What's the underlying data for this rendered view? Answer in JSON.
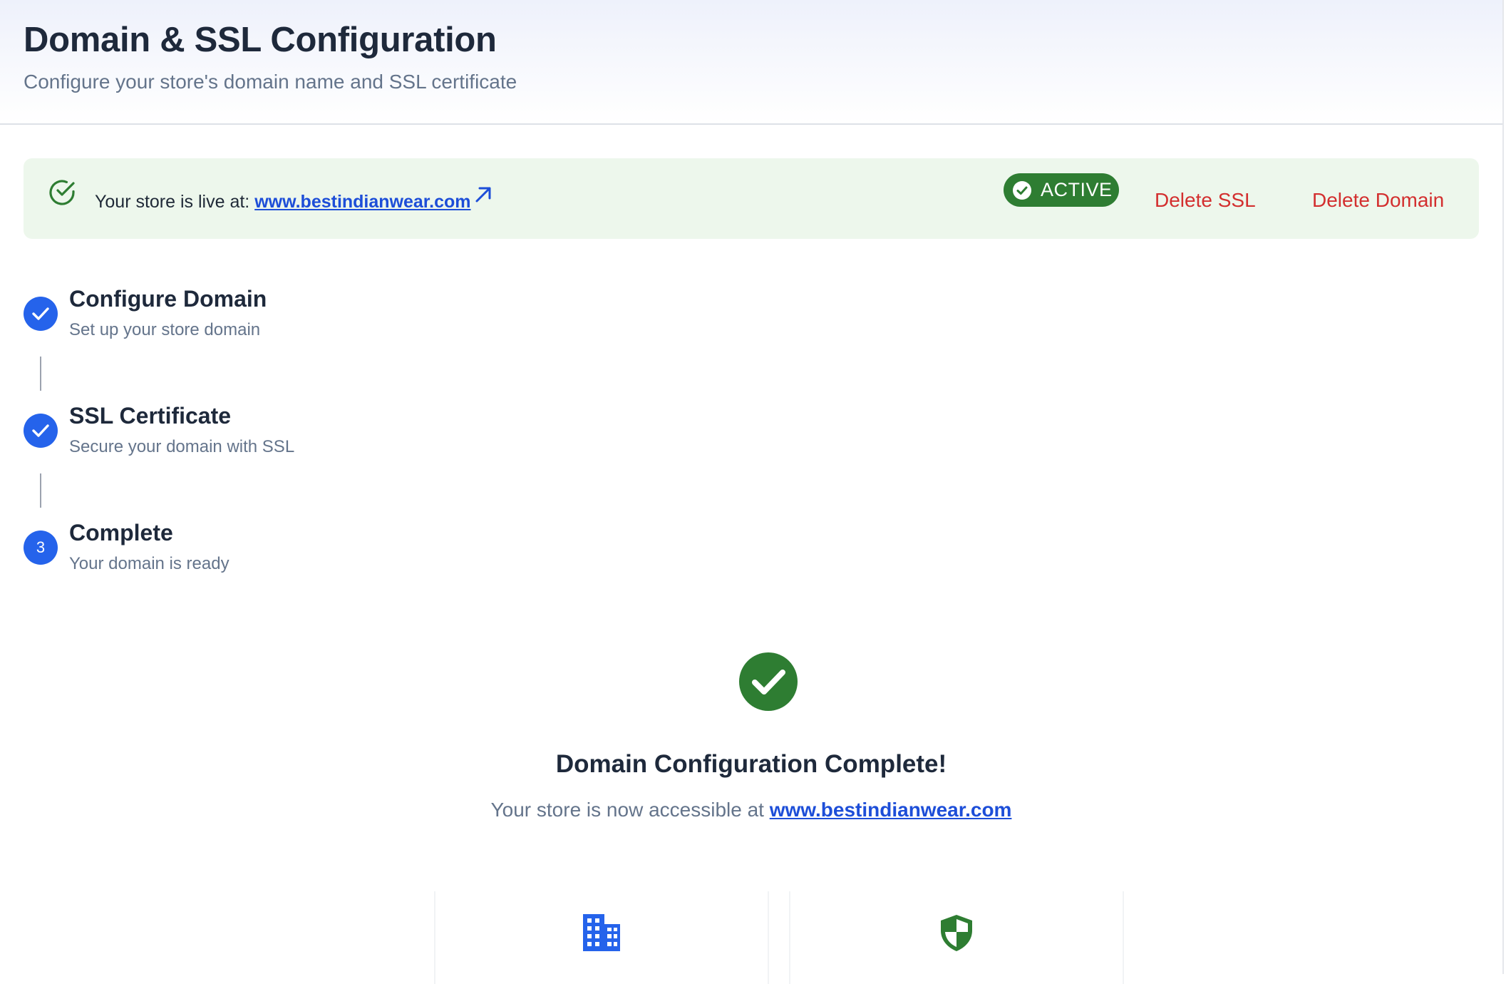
{
  "header": {
    "title": "Domain & SSL Configuration",
    "subtitle": "Configure your store's domain name and SSL certificate"
  },
  "banner": {
    "live_prefix": "Your store is live at: ",
    "domain": "www.bestindianwear.com",
    "status_badge": "ACTIVE",
    "delete_ssl_label": "Delete SSL",
    "delete_domain_label": "Delete Domain"
  },
  "steps": [
    {
      "title": "Configure Domain",
      "description": "Set up your store domain",
      "state": "complete"
    },
    {
      "title": "SSL Certificate",
      "description": "Secure your domain with SSL",
      "state": "complete"
    },
    {
      "title": "Complete",
      "description": "Your domain is ready",
      "state": "current",
      "number": "3"
    }
  ],
  "completion": {
    "title": "Domain Configuration Complete!",
    "message_prefix": "Your store is now accessible at ",
    "domain": "www.bestindianwear.com"
  },
  "cards": [
    {
      "icon": "building-icon"
    },
    {
      "icon": "shield-icon"
    }
  ],
  "colors": {
    "primary": "#2563eb",
    "success": "#2e7d32",
    "danger": "#d32f2f",
    "banner_bg": "#edf7ec"
  }
}
